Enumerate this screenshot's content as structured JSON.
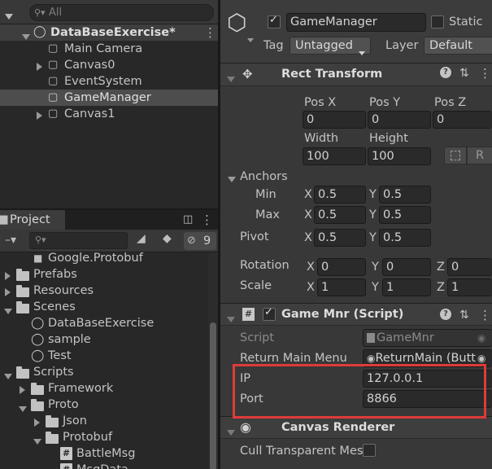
{
  "hierarchy": {
    "search_placeholder": "All",
    "scene": "DataBaseExercise*",
    "items": [
      {
        "label": "Main Camera"
      },
      {
        "label": "Canvas0"
      },
      {
        "label": "EventSystem"
      },
      {
        "label": "GameManager"
      },
      {
        "label": "Canvas1"
      }
    ]
  },
  "project": {
    "tab": "Project",
    "hidden_count": "9",
    "tree": [
      {
        "label": "Google.Protobuf"
      },
      {
        "label": "Prefabs"
      },
      {
        "label": "Resources"
      },
      {
        "label": "Scenes"
      },
      {
        "label": "DataBaseExercise"
      },
      {
        "label": "sample"
      },
      {
        "label": "Test"
      },
      {
        "label": "Scripts"
      },
      {
        "label": "Framework"
      },
      {
        "label": "Proto"
      },
      {
        "label": "Json"
      },
      {
        "label": "Protobuf"
      },
      {
        "label": "BattleMsg"
      },
      {
        "label": "MsgData"
      }
    ]
  },
  "inspector": {
    "object_name": "GameManager",
    "static_label": "Static",
    "tag_label": "Tag",
    "tag_value": "Untagged",
    "layer_label": "Layer",
    "layer_value": "Default",
    "rect_transform": {
      "title": "Rect Transform",
      "pos_x_label": "Pos X",
      "pos_y_label": "Pos Y",
      "pos_z_label": "Pos Z",
      "pos_x": "0",
      "pos_y": "0",
      "pos_z": "0",
      "width_label": "Width",
      "height_label": "Height",
      "width": "100",
      "height": "100",
      "r_button": "R",
      "anchors_label": "Anchors",
      "min_label": "Min",
      "max_label": "Max",
      "min_x": "0.5",
      "min_y": "0.5",
      "max_x": "0.5",
      "max_y": "0.5",
      "pivot_label": "Pivot",
      "pivot_x": "0.5",
      "pivot_y": "0.5",
      "rotation_label": "Rotation",
      "rot_x": "0",
      "rot_y": "0",
      "rot_z": "0",
      "scale_label": "Scale",
      "scale_x": "1",
      "scale_y": "1",
      "scale_z": "1",
      "x": "X",
      "y": "Y",
      "z": "Z"
    },
    "game_mnr": {
      "title": "Game Mnr (Script)",
      "script_label": "Script",
      "script_value": "GameMnr",
      "return_label": "Return Main Menu",
      "return_value": "ReturnMain (Butt",
      "ip_label": "IP",
      "ip_value": "127.0.0.1",
      "port_label": "Port",
      "port_value": "8866"
    },
    "canvas_renderer": {
      "title": "Canvas Renderer",
      "cull_label": "Cull Transparent Mes"
    }
  },
  "colors": {
    "highlight_box": "#e03a3a",
    "selected_row": "#4d4d4d",
    "script_check": "#49a05a"
  }
}
